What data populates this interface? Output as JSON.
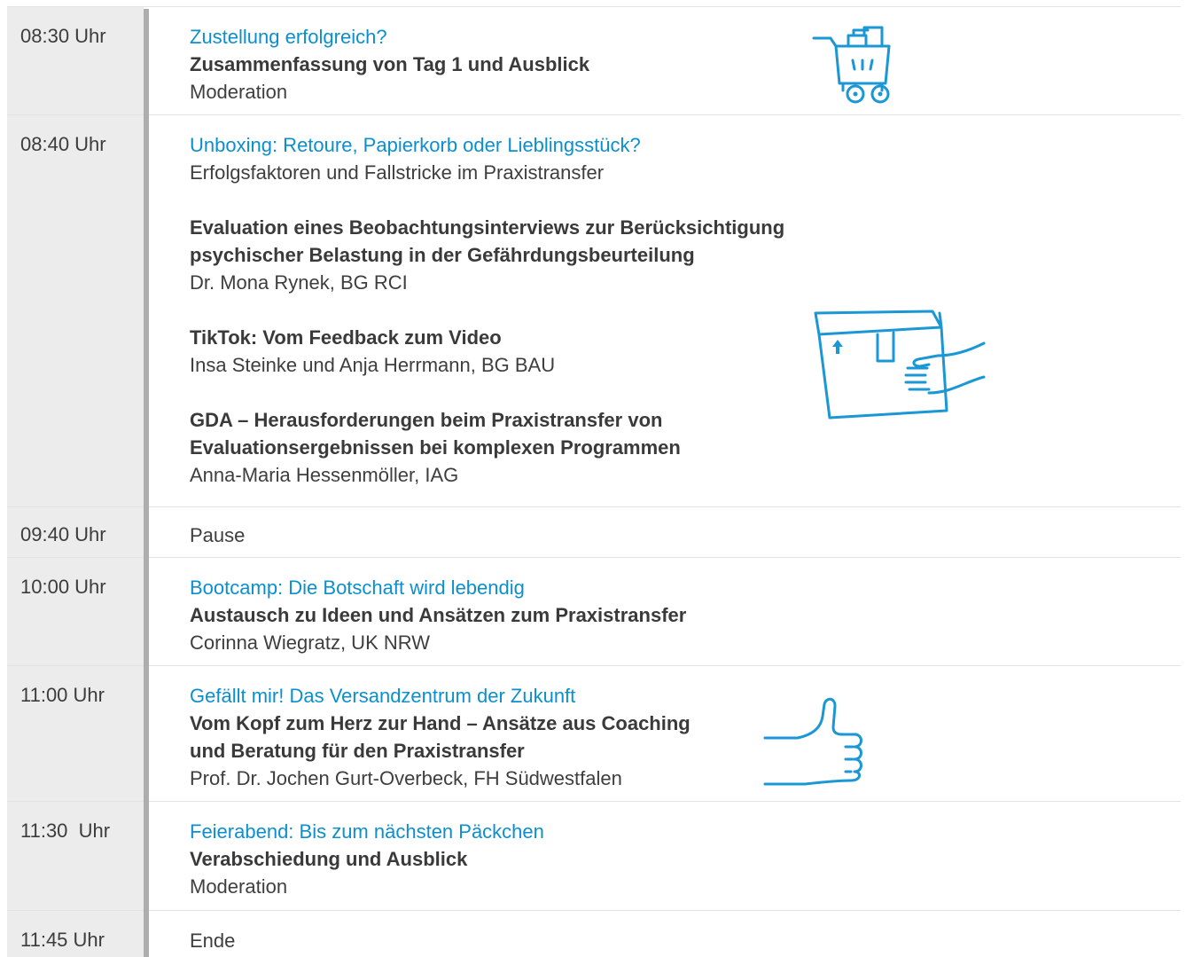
{
  "rows": [
    {
      "time": "08:30 Uhr",
      "headline": "Zustellung erfolgreich?",
      "title": "Zusammenfassung von Tag 1 und Ausblick",
      "speaker": "Moderation"
    },
    {
      "time": "08:40 Uhr",
      "headline": "Unboxing: Retoure, Papierkorb oder Lieblingsstück?",
      "subtitle": "Erfolgsfaktoren und Fallstricke im Praxistransfer",
      "talks": [
        {
          "title_lines": [
            "Evaluation eines Beobachtungsinterviews zur Berücksichtigung",
            "psychischer Belastung in der Gefährdungsbeurteilung"
          ],
          "speaker": "Dr. Mona Rynek, BG RCI"
        },
        {
          "title_lines": [
            "TikTok: Vom Feedback zum Video"
          ],
          "speaker": "Insa Steinke und Anja Herrmann, BG BAU"
        },
        {
          "title_lines": [
            "GDA – Herausforderungen beim Praxistransfer von",
            "Evaluationsergebnissen bei komplexen Programmen"
          ],
          "speaker": "Anna-Maria Hessenmöller, IAG"
        }
      ]
    },
    {
      "time": "09:40 Uhr",
      "text": "Pause"
    },
    {
      "time": "10:00 Uhr",
      "headline": "Bootcamp: Die Botschaft wird lebendig",
      "title": "Austausch zu Ideen und Ansätzen zum Praxistransfer",
      "speaker": "Corinna Wiegratz, UK NRW"
    },
    {
      "time": "11:00 Uhr",
      "headline": "Gefällt mir! Das Versandzentrum der Zukunft",
      "title_lines": [
        "Vom Kopf zum Herz zur Hand – Ansätze aus Coaching",
        "und Beratung für den Praxistransfer"
      ],
      "speaker": "Prof. Dr. Jochen Gurt-Overbeck, FH Südwestfalen"
    },
    {
      "time": "11:30  Uhr",
      "headline": "Feierabend: Bis zum nächsten Päckchen",
      "title": "Verabschiedung und Ausblick",
      "speaker": "Moderation"
    },
    {
      "time": "11:45 Uhr",
      "text": "Ende"
    }
  ],
  "icons": [
    "shopping-cart-icon",
    "parcel-box-icon",
    "thumbs-up-icon"
  ],
  "colors": {
    "accent": "#0b8fce",
    "time_cell": "#ececec",
    "timeline": "#aeaeae",
    "text": "#3c3c3c"
  }
}
